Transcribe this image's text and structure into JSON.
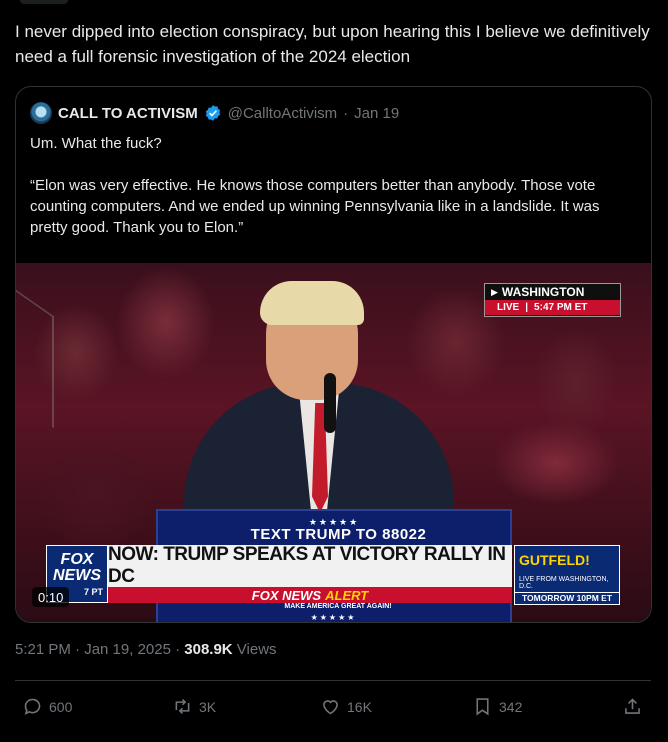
{
  "post": {
    "text": "I never dipped into election conspiracy, but upon hearing  this I believe we definitively need a full forensic investigation of the 2024 election",
    "timestamp": "5:21 PM · Jan 19, 2025 · ",
    "views_count": "308.9K",
    "views_label": " Views"
  },
  "quote": {
    "author_name": "CALL TO ACTIVISM",
    "handle": "@CalltoActivism",
    "separator": "·",
    "date": "Jan 19",
    "line1": "Um. What the fuck?",
    "line2": "“Elon was very effective. He knows those computers better than anybody. Those vote counting computers. And we ended up winning Pennsylvania like in a landslide. It was pretty good. Thank you to Elon.”",
    "verified_icon": "verified-badge-icon"
  },
  "video": {
    "duration": "0:10",
    "live_location": "WASHINGTON",
    "live_label": "LIVE",
    "live_time": "5:47 PM ET",
    "podium_stars": "★★★★★",
    "podium_text_prefix": "TEXT ",
    "podium_text_name": "TRUMP",
    "podium_text_suffix": " TO 88022",
    "headline": "NOW: TRUMP SPEAKS AT VICTORY RALLY IN DC",
    "network_alert_prefix": "FOX NEWS",
    "network_alert_word": "ALERT",
    "fox_logo_line1": "FOX",
    "fox_logo_line2": "NEWS",
    "fox_logo_time": "7 PT",
    "promo_show": "GUTFELD!",
    "promo_live": "LIVE FROM WASHINGTON, D.C.",
    "promo_time": "TOMORROW 10PM ET",
    "podium_slogan": "MAKE AMERICA GREAT AGAIN!",
    "podium_stars_bottom": "★★★★★"
  },
  "actions": {
    "replies": "600",
    "reposts": "3K",
    "likes": "16K",
    "bookmarks": "342"
  },
  "colors": {
    "background": "#000000",
    "text": "#e7e9ea",
    "muted": "#71767b",
    "border": "#2f3336",
    "verified": "#1d9bf0"
  }
}
